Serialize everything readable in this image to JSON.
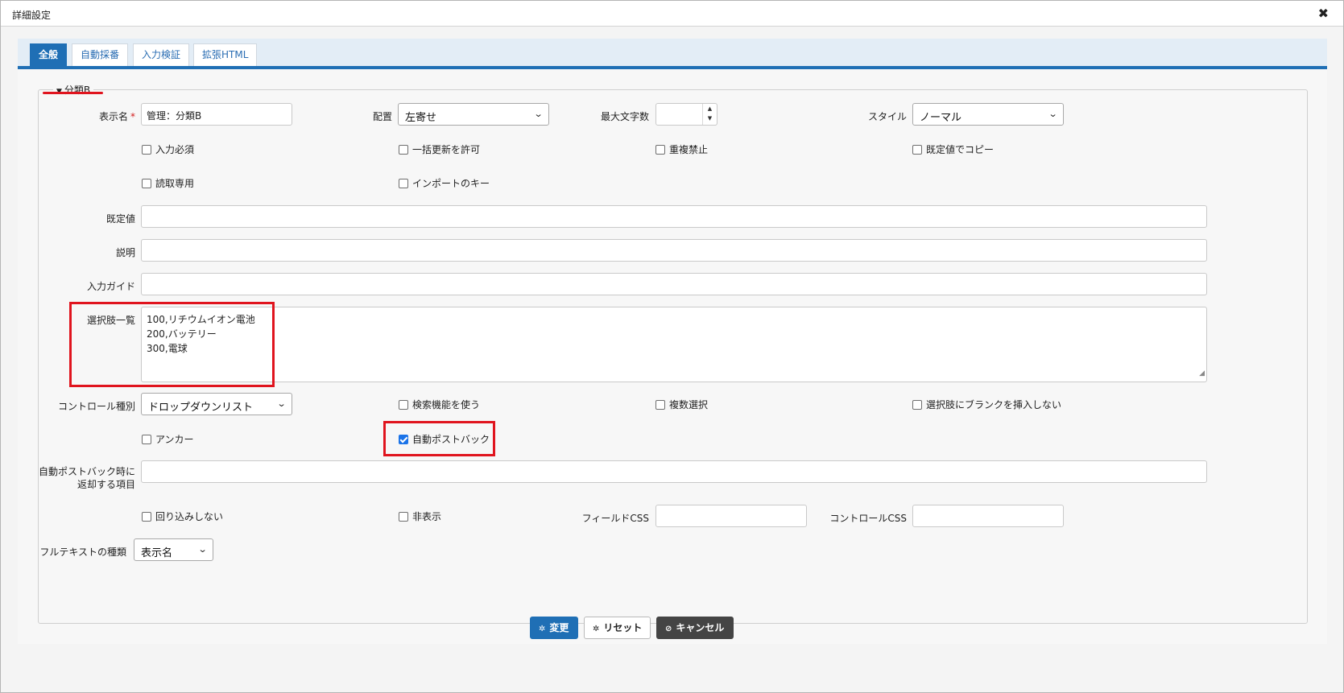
{
  "dialog": {
    "title": "詳細設定",
    "close_icon": "✖"
  },
  "tabs": [
    {
      "label": "全般",
      "active": true
    },
    {
      "label": "自動採番",
      "active": false
    },
    {
      "label": "入力検証",
      "active": false
    },
    {
      "label": "拡張HTML",
      "active": false
    }
  ],
  "section": {
    "legend": "分類B",
    "collapse_icon": "▼"
  },
  "fields": {
    "display_name": {
      "label": "表示名",
      "required_mark": "*",
      "value": "管理：分類B"
    },
    "alignment": {
      "label": "配置",
      "value": "左寄せ"
    },
    "max_length": {
      "label": "最大文字数",
      "value": ""
    },
    "style": {
      "label": "スタイル",
      "value": "ノーマル"
    },
    "default_value": {
      "label": "既定値",
      "value": ""
    },
    "description": {
      "label": "説明",
      "value": ""
    },
    "input_guide": {
      "label": "入力ガイド",
      "value": ""
    },
    "choices": {
      "label": "選択肢一覧",
      "lines": [
        "100,リチウムイオン電池",
        "200,バッテリー",
        "300,電球"
      ]
    },
    "control_type": {
      "label": "コントロール種別",
      "value": "ドロップダウンリスト"
    },
    "postback_return": {
      "label_line1": "自動ポストバック時に",
      "label_line2": "返却する項目",
      "value": ""
    },
    "field_css": {
      "label": "フィールドCSS",
      "value": ""
    },
    "control_css": {
      "label": "コントロールCSS",
      "value": ""
    },
    "fulltext_type": {
      "label": "フルテキストの種類",
      "value": "表示名"
    }
  },
  "checkboxes": {
    "required": {
      "label": "入力必須",
      "checked": false
    },
    "bulk_update": {
      "label": "一括更新を許可",
      "checked": false
    },
    "no_duplicate": {
      "label": "重複禁止",
      "checked": false
    },
    "copy_default": {
      "label": "既定値でコピー",
      "checked": false
    },
    "read_only": {
      "label": "読取専用",
      "checked": false
    },
    "import_key": {
      "label": "インポートのキー",
      "checked": false
    },
    "use_search": {
      "label": "検索機能を使う",
      "checked": false
    },
    "multi_select": {
      "label": "複数選択",
      "checked": false
    },
    "no_blank": {
      "label": "選択肢にブランクを挿入しない",
      "checked": false
    },
    "anchor": {
      "label": "アンカー",
      "checked": false
    },
    "auto_postback": {
      "label": "自動ポストバック",
      "checked": true
    },
    "no_wrap": {
      "label": "回り込みしない",
      "checked": false
    },
    "hidden": {
      "label": "非表示",
      "checked": false
    }
  },
  "buttons": {
    "change": {
      "label": "変更",
      "icon": "✲"
    },
    "reset": {
      "label": "リセット",
      "icon": "✲"
    },
    "cancel": {
      "label": "キャンセル",
      "icon": "⊘"
    }
  },
  "colors": {
    "accent": "#1f6fb5",
    "highlight": "#e0141e"
  }
}
